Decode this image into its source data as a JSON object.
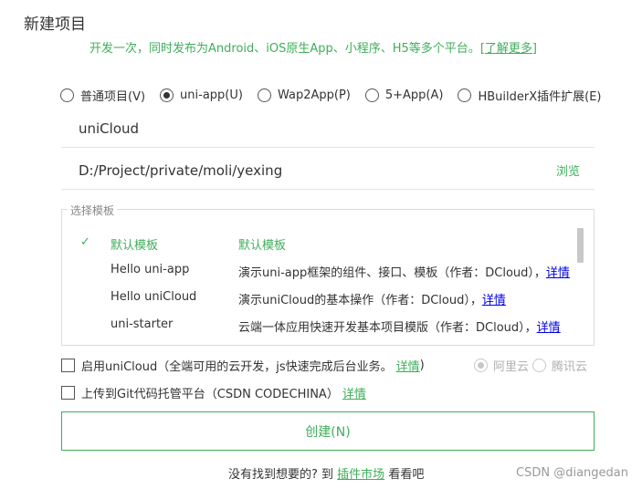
{
  "header": {
    "title": "新建项目",
    "subtitle": "开发一次，同时发布为Android、iOS原生App、小程序、H5等多个平台。",
    "learn_more": "[了解更多]"
  },
  "project_types": [
    {
      "label": "普通项目(V)",
      "checked": false
    },
    {
      "label": "uni-app(U)",
      "checked": true
    },
    {
      "label": "Wap2App(P)",
      "checked": false
    },
    {
      "label": "5+App(A)",
      "checked": false
    },
    {
      "label": "HBuilderX插件扩展(E)",
      "checked": false
    }
  ],
  "project_name": {
    "value": "uniCloud"
  },
  "project_path": {
    "value": "D:/Project/private/moli/yexing",
    "browse_label": "浏览"
  },
  "templates": {
    "legend": "选择模板",
    "rows": [
      {
        "check": "✓",
        "name": "默认模板",
        "desc": "默认模板",
        "link": "",
        "selected": true
      },
      {
        "check": "",
        "name": "Hello uni-app",
        "desc": "演示uni-app框架的组件、接口、模板（作者：DCloud），",
        "link": "详情",
        "selected": false
      },
      {
        "check": "",
        "name": "Hello uniCloud",
        "desc": "演示uniCloud的基本操作（作者：DCloud），",
        "link": "详情",
        "selected": false
      },
      {
        "check": "",
        "name": "uni-starter",
        "desc": "云端一体应用快速开发基本项目模版（作者：DCloud），",
        "link": "详情",
        "selected": false
      }
    ]
  },
  "unicloud_option": {
    "label": "启用uniCloud（全端可用的云开发，js快速完成后台业务。",
    "link": "详情",
    "suffix": ")"
  },
  "cloud_providers": [
    {
      "label": "阿里云",
      "checked": true
    },
    {
      "label": "腾讯云",
      "checked": false
    }
  ],
  "git_option": {
    "label": "上传到Git代码托管平台（CSDN CODECHINA）",
    "link": "详情"
  },
  "create_button": {
    "label": "创建(N)"
  },
  "footer": {
    "prefix": "没有找到想要的? 到 ",
    "link": "插件市场",
    "suffix": " 看看吧"
  },
  "watermark": "CSDN @diangedan",
  "colors": {
    "accent": "#3fae5a",
    "link_blue": "#0000ee"
  }
}
